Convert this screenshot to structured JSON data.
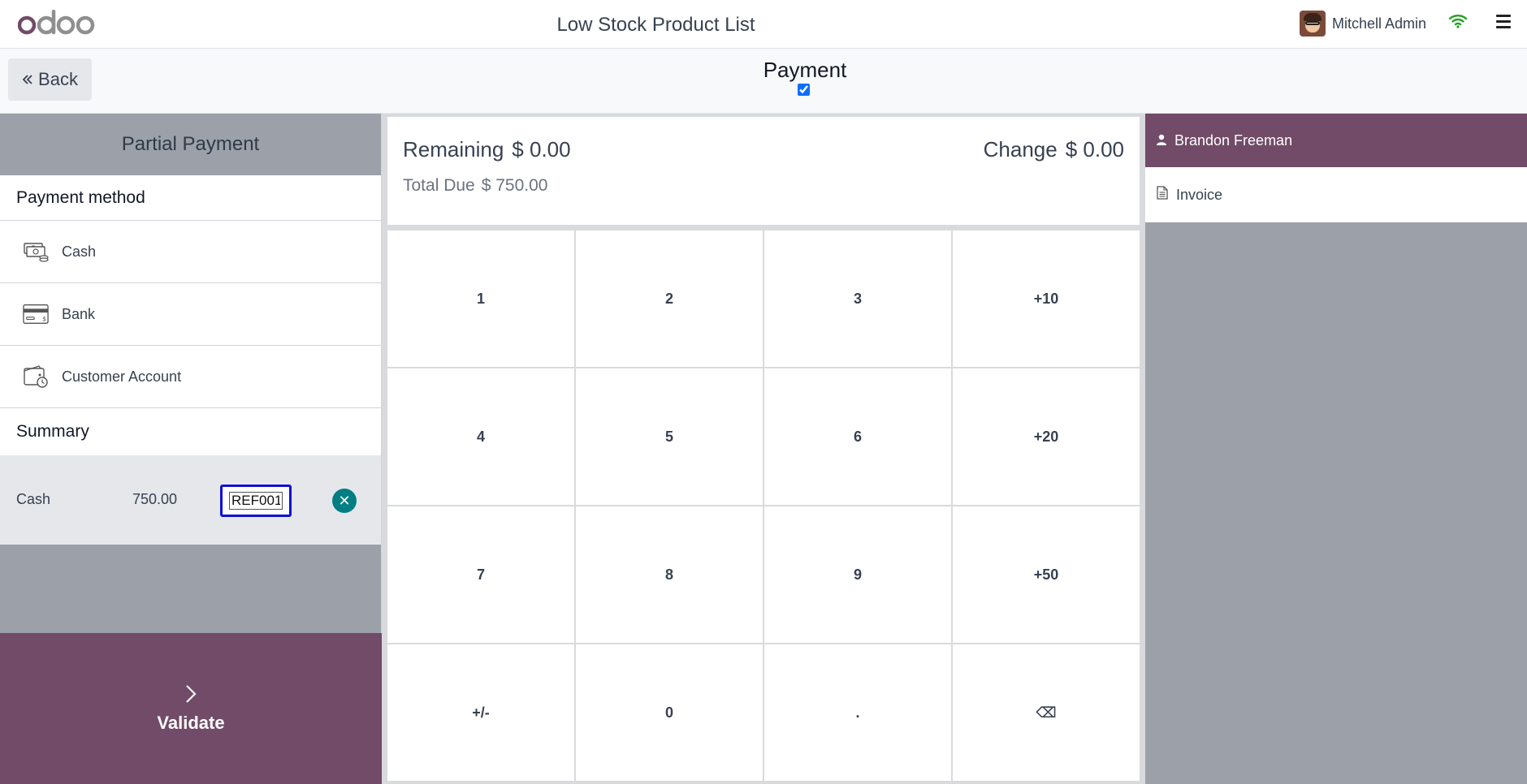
{
  "header": {
    "logo": "odoo",
    "title": "Low Stock Product List",
    "user_name": "Mitchell Admin"
  },
  "controls": {
    "back_label": "Back",
    "screen_title": "Payment",
    "checkbox_checked": true
  },
  "left_panel": {
    "partial_payment_label": "Partial Payment",
    "payment_method_heading": "Payment method",
    "payment_methods": [
      {
        "label": "Cash",
        "icon": "cash-icon"
      },
      {
        "label": "Bank",
        "icon": "bank-card-icon"
      },
      {
        "label": "Customer Account",
        "icon": "wallet-clock-icon"
      }
    ],
    "summary_heading": "Summary",
    "payment_line": {
      "method": "Cash",
      "amount": "750.00",
      "reference": "REF001"
    },
    "validate_label": "Validate"
  },
  "status": {
    "remaining_label": "Remaining",
    "remaining_value": "$ 0.00",
    "change_label": "Change",
    "change_value": "$ 0.00",
    "total_due_label": "Total Due",
    "total_due_value": "$ 750.00"
  },
  "numpad": [
    "1",
    "2",
    "3",
    "+10",
    "4",
    "5",
    "6",
    "+20",
    "7",
    "8",
    "9",
    "+50",
    "+/-",
    "0",
    ".",
    "⌫"
  ],
  "right_panel": {
    "customer_name": "Brandon Freeman",
    "invoice_label": "Invoice"
  },
  "colors": {
    "brand": "#714b67",
    "teal": "#017e84",
    "panel_gray": "#9ca0a9",
    "focus_outline": "#1010d8"
  }
}
